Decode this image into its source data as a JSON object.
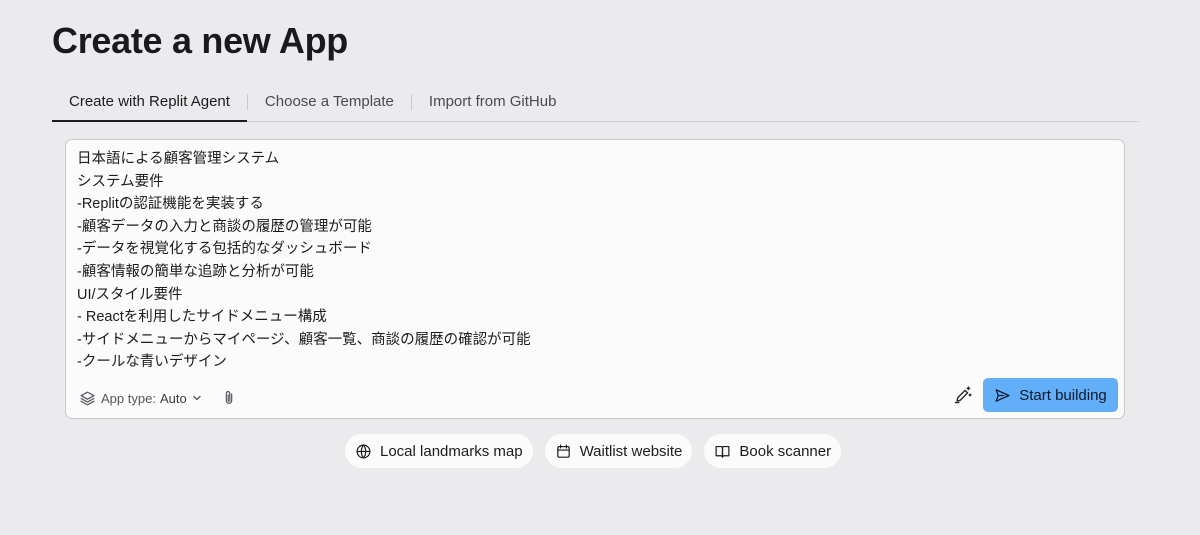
{
  "page": {
    "title": "Create a new App"
  },
  "tabs": [
    {
      "label": "Create with Replit Agent",
      "active": true
    },
    {
      "label": "Choose a Template",
      "active": false
    },
    {
      "label": "Import from GitHub",
      "active": false
    }
  ],
  "prompt": {
    "lines": [
      "日本語による顧客管理システム",
      "システム要件",
      "-Replitの認証機能を実装する",
      "-顧客データの入力と商談の履歴の管理が可能",
      "-データを視覚化する包括的なダッシュボード",
      "-顧客情報の簡単な追跡と分析が可能",
      "UI/スタイル要件",
      "- Reactを利用したサイドメニュー構成",
      "-サイドメニューからマイページ、顧客一覧、商談の履歴の確認が可能",
      "-クールな青いデザイン"
    ]
  },
  "toolbar": {
    "app_type_label": "App type:",
    "app_type_value": "Auto",
    "app_type_icon": "layers-icon",
    "attach_icon": "paperclip-icon",
    "enhance_icon": "pen-sparkle-icon",
    "start_label": "Start building",
    "start_icon": "send-icon",
    "accent_color": "#63aef8"
  },
  "suggestions": [
    {
      "label": "Local landmarks map",
      "icon": "globe-icon"
    },
    {
      "label": "Waitlist website",
      "icon": "calendar-icon"
    },
    {
      "label": "Book scanner",
      "icon": "book-icon"
    }
  ]
}
